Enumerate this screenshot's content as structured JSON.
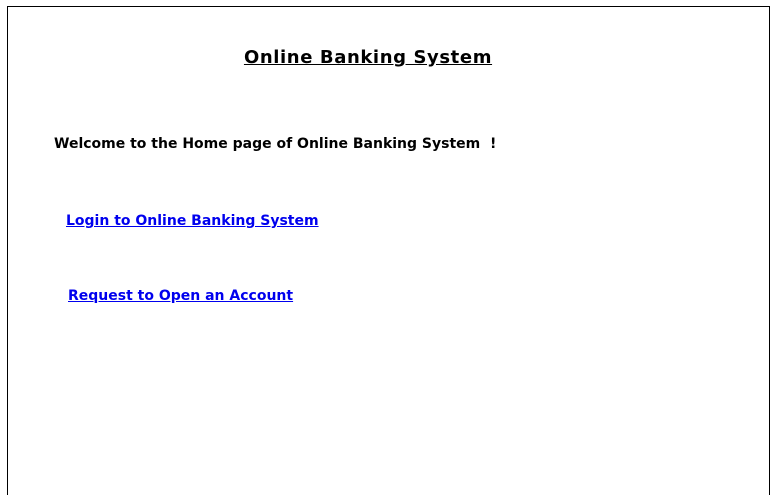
{
  "page": {
    "title": "Online Banking System",
    "welcome": "Welcome to the Home page of Online Banking System  !"
  },
  "links": {
    "login": "Login to Online Banking System",
    "request_account": "Request to Open an Account"
  },
  "colors": {
    "link": "#0000ee",
    "text": "#000000",
    "background": "#ffffff"
  }
}
